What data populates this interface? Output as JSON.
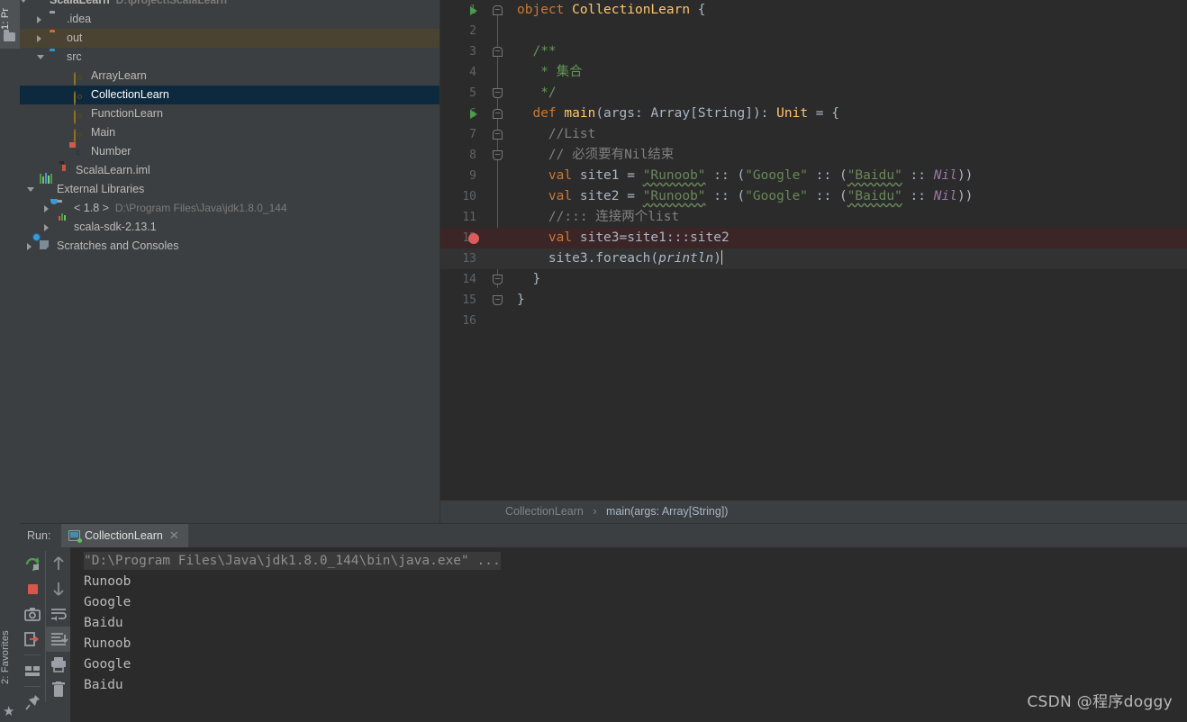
{
  "toolwindows": {
    "project_tab": "1: Pr",
    "favorites_tab": "2: Favorites",
    "project_icon": "folder-icon",
    "favorites_icon": "star-icon"
  },
  "project_tree": {
    "items": [
      {
        "label": "ScalaLearn",
        "sublabel": "D:\\project\\ScalaLearn",
        "icon": "module-icon",
        "indent": 14,
        "arrow": "down",
        "state": "normal",
        "bold": true
      },
      {
        "label": ".idea",
        "sublabel": "",
        "icon": "folder-gray-icon",
        "indent": 33,
        "arrow": "right",
        "state": "normal",
        "bold": false
      },
      {
        "label": "out",
        "sublabel": "",
        "icon": "folder-orange-icon",
        "indent": 33,
        "arrow": "right",
        "state": "brown",
        "bold": false
      },
      {
        "label": "src",
        "sublabel": "",
        "icon": "folder-blue-icon",
        "indent": 33,
        "arrow": "down",
        "state": "normal",
        "bold": false
      },
      {
        "label": "ArrayLearn",
        "sublabel": "",
        "icon": "scala-object-icon",
        "indent": 60,
        "arrow": "none",
        "state": "normal",
        "bold": false
      },
      {
        "label": "CollectionLearn",
        "sublabel": "",
        "icon": "scala-object-icon",
        "indent": 60,
        "arrow": "none",
        "state": "selected",
        "bold": false
      },
      {
        "label": "FunctionLearn",
        "sublabel": "",
        "icon": "scala-object-icon",
        "indent": 60,
        "arrow": "none",
        "state": "normal",
        "bold": false
      },
      {
        "label": "Main",
        "sublabel": "",
        "icon": "scala-object-icon",
        "indent": 60,
        "arrow": "none",
        "state": "normal",
        "bold": false
      },
      {
        "label": "Number",
        "sublabel": "",
        "icon": "scala-class-icon",
        "indent": 60,
        "arrow": "none",
        "state": "normal",
        "bold": false
      },
      {
        "label": "ScalaLearn.iml",
        "sublabel": "",
        "icon": "iml-file-icon",
        "indent": 43,
        "arrow": "none",
        "state": "normal",
        "bold": false
      },
      {
        "label": "External Libraries",
        "sublabel": "",
        "icon": "libraries-icon",
        "indent": 22,
        "arrow": "down",
        "state": "normal",
        "bold": false
      },
      {
        "label": "< 1.8 >",
        "sublabel": "D:\\Program Files\\Java\\jdk1.8.0_144",
        "icon": "jdk-icon",
        "indent": 41,
        "arrow": "right",
        "state": "normal",
        "bold": false
      },
      {
        "label": "scala-sdk-2.13.1",
        "sublabel": "",
        "icon": "scala-sdk-icon",
        "indent": 41,
        "arrow": "right",
        "state": "normal",
        "bold": false
      },
      {
        "label": "Scratches and Consoles",
        "sublabel": "",
        "icon": "scratches-icon",
        "indent": 22,
        "arrow": "right",
        "state": "normal",
        "bold": false
      }
    ]
  },
  "editor": {
    "lines": [
      {
        "no": "1",
        "state": "normal",
        "gutter": "run",
        "fold": "capup",
        "html": "<span class='kw'>object</span> <span class='fn'>CollectionLearn</span> {"
      },
      {
        "no": "2",
        "state": "normal",
        "gutter": "",
        "fold": "",
        "html": ""
      },
      {
        "no": "3",
        "state": "normal",
        "gutter": "",
        "fold": "capup",
        "html": "  <span class='doc'>/**</span>"
      },
      {
        "no": "4",
        "state": "normal",
        "gutter": "",
        "fold": "",
        "html": "   <span class='doc'>* 集合</span>"
      },
      {
        "no": "5",
        "state": "normal",
        "gutter": "",
        "fold": "cap",
        "html": "   <span class='doc'>*/</span>"
      },
      {
        "no": "6",
        "state": "normal",
        "gutter": "run",
        "fold": "capup",
        "html": "  <span class='kw'>def</span> <span class='fn'>main</span>(args: <span class='typ'>Array</span>[<span class='typ'>String</span>]): <span class='fn'>Unit</span> = {"
      },
      {
        "no": "7",
        "state": "normal",
        "gutter": "",
        "fold": "capup",
        "html": "    <span class='cmt'>//List</span>"
      },
      {
        "no": "8",
        "state": "normal",
        "gutter": "",
        "fold": "cap",
        "html": "    <span class='cmt'>// 必须要有Nil结束</span>"
      },
      {
        "no": "9",
        "state": "normal",
        "gutter": "",
        "fold": "",
        "html": "    <span class='kw'>val</span> site1 = <span class='str wavy'>\"Runoob\"</span> :: (<span class='str'>\"Google\"</span> :: (<span class='str wavy'>\"Baidu\"</span> :: <span class='nil'>Nil</span>))"
      },
      {
        "no": "10",
        "state": "normal",
        "gutter": "",
        "fold": "",
        "html": "    <span class='kw'>val</span> site2 = <span class='str wavy'>\"Runoob\"</span> :: (<span class='str'>\"Google\"</span> :: (<span class='str wavy'>\"Baidu\"</span> :: <span class='nil'>Nil</span>))"
      },
      {
        "no": "11",
        "state": "normal",
        "gutter": "",
        "fold": "",
        "html": "    <span class='cmt'>//::: 连接两个list</span>"
      },
      {
        "no": "12",
        "state": "err",
        "gutter": "breakpoint",
        "fold": "",
        "html": "    <span class='kw'>val</span> site3=site1:::site2"
      },
      {
        "no": "13",
        "state": "cur",
        "gutter": "",
        "fold": "",
        "html": "    site3.foreach(<span class='ital'>println</span>)<span class='caret'></span>"
      },
      {
        "no": "14",
        "state": "normal",
        "gutter": "",
        "fold": "cap",
        "html": "  }"
      },
      {
        "no": "15",
        "state": "normal",
        "gutter": "",
        "fold": "cap",
        "html": "}"
      },
      {
        "no": "16",
        "state": "normal",
        "gutter": "",
        "fold": "",
        "html": ""
      }
    ]
  },
  "breadcrumb": {
    "class": "CollectionLearn",
    "separator": "›",
    "method": "main(args: Array[String])"
  },
  "run_panel": {
    "label": "Run:",
    "tab_title": "CollectionLearn",
    "tab_icon": "run-config-icon",
    "close_icon": "close-icon",
    "toolbar_left": [
      {
        "name": "rerun-icon",
        "title": "Rerun"
      },
      {
        "name": "stop-icon",
        "title": "Stop"
      },
      {
        "name": "camera-icon",
        "title": "Dump Threads"
      },
      {
        "name": "export-icon",
        "title": "Export"
      },
      {
        "name": "layout-icon",
        "title": "Layout Settings"
      },
      {
        "name": "pin-icon",
        "title": "Pin Tab"
      }
    ],
    "toolbar_right": [
      {
        "name": "arrow-up-icon",
        "title": "Up the Stack Trace"
      },
      {
        "name": "arrow-down-icon",
        "title": "Down the Stack Trace"
      },
      {
        "name": "soft-wrap-icon",
        "title": "Use Soft Wraps"
      },
      {
        "name": "scroll-to-end-icon",
        "title": "Scroll to the End",
        "active": true
      },
      {
        "name": "print-icon",
        "title": "Print"
      },
      {
        "name": "trash-icon",
        "title": "Clear All"
      }
    ],
    "console_lines": [
      {
        "text": "\"D:\\Program Files\\Java\\jdk1.8.0_144\\bin\\java.exe\" ...",
        "type": "cmd"
      },
      {
        "text": "Runoob",
        "type": "out"
      },
      {
        "text": "Google",
        "type": "out"
      },
      {
        "text": "Baidu",
        "type": "out"
      },
      {
        "text": "Runoob",
        "type": "out"
      },
      {
        "text": "Google",
        "type": "out"
      },
      {
        "text": "Baidu",
        "type": "out"
      }
    ]
  },
  "watermark": {
    "text": "CSDN @程序doggy"
  },
  "colors": {
    "panel_bg": "#3c3f41",
    "editor_bg": "#2b2b2b",
    "selection_blue": "#0d293e",
    "selection_brown": "#4a4331",
    "error_line": "#3b2526",
    "current_line": "#323232",
    "keyword": "#cc7832",
    "string": "#6a8759",
    "comment": "#808080",
    "doc_comment": "#629755",
    "function": "#ffc66d",
    "literal": "#9876aa",
    "text": "#a9b7c6"
  }
}
